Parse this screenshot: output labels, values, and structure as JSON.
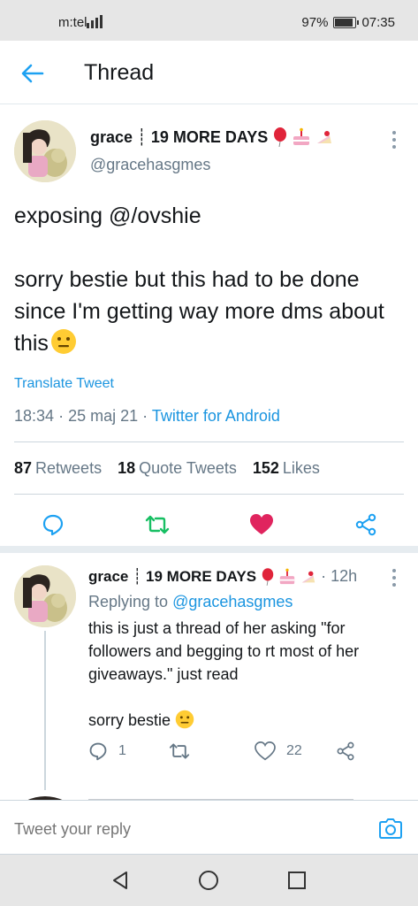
{
  "status_bar": {
    "carrier": "m:tel",
    "battery_percent": "97%",
    "battery_level": 0.97,
    "time": "07:35"
  },
  "header": {
    "title": "Thread",
    "back_icon": "arrow-left-icon",
    "accent_color": "#1da1f2"
  },
  "main_tweet": {
    "display_name": "grace ┊ 19 MORE DAYS",
    "name_emojis": [
      "balloon",
      "birthday-cake",
      "shortcake"
    ],
    "handle": "@gracehasgmes",
    "body_line1": "exposing @/ovshie",
    "body_line2": "sorry bestie but this had to be done since I'm getting way more dms about this",
    "body_emoji": "neutral-face",
    "translate_label": "Translate Tweet",
    "time": "18:34",
    "date": "25 maj 21",
    "separator": "·",
    "source": "Twitter for Android",
    "stats": {
      "retweets_count": "87",
      "retweets_label": "Retweets",
      "quotes_count": "18",
      "quotes_label": "Quote Tweets",
      "likes_count": "152",
      "likes_label": "Likes"
    },
    "actions": [
      "reply-icon",
      "retweet-icon",
      "like-icon",
      "share-icon"
    ],
    "retweeted_color": "#17bf63",
    "liked_color": "#e0245e"
  },
  "reply_tweet": {
    "display_name": "grace ┊ 19 MORE DAYS",
    "time": "· 12h",
    "replying_to_label": "Replying to",
    "replying_to_handle": "@gracehasgmes",
    "body_line1": "this is just a thread of her asking \"for followers and begging to rt most of her giveaways.\" just read",
    "body_line2": "sorry bestie",
    "reply_count": "1",
    "retweet_count": "",
    "like_count": "22"
  },
  "reply_bar": {
    "placeholder": "Tweet your reply",
    "camera_icon": "camera-icon"
  },
  "nav_bar": {
    "buttons": [
      "back-triangle-icon",
      "home-circle-icon",
      "recents-square-icon"
    ]
  }
}
